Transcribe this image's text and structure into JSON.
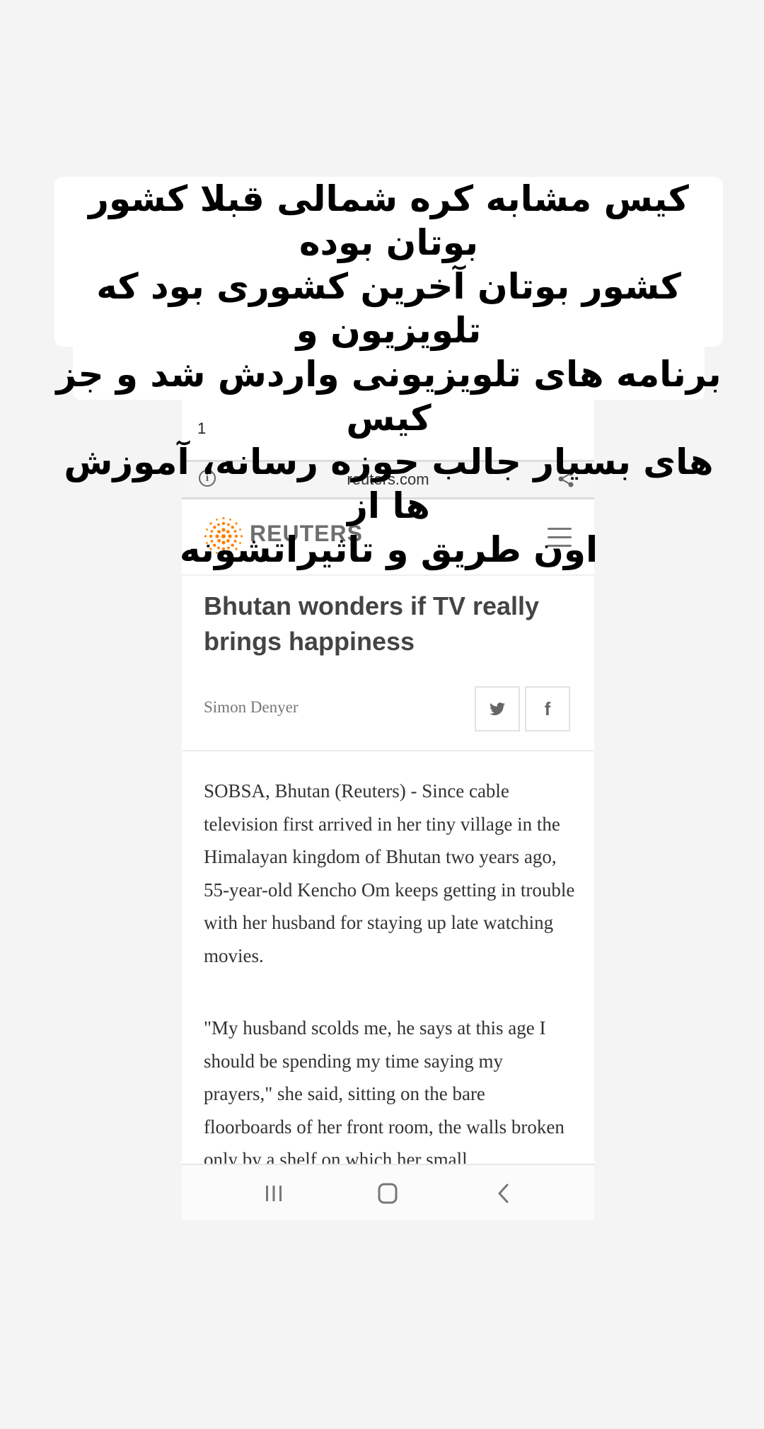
{
  "caption": {
    "lines": [
      "کیس مشابه کره شمالی قبلا کشور بوتان بوده",
      "کشور بوتان آخرین کشوری بود که تلویزیون و",
      "برنامه های تلویزیونی واردش شد و جز کیس",
      "های بسیار جالب حوزه رسانه، آموزش ها از",
      "اون طریق و تاثیراتشونه"
    ]
  },
  "status": {
    "text": "1"
  },
  "browser": {
    "url": "reuters.com"
  },
  "site": {
    "brand": "REUTERS",
    "brand_color": "#ff8000"
  },
  "article": {
    "headline": "Bhutan wonders if TV really brings happiness",
    "author": "Simon Denyer",
    "paragraphs": [
      "SOBSA, Bhutan (Reuters) - Since cable television first arrived in her tiny village in the Himalayan kingdom of Bhutan two years ago, 55-year-old Kencho Om keeps getting in trouble with her husband for staying up late watching movies.",
      "\"My husband scolds me, he says at this age I should be spending my time saying my prayers,\" she said, sitting on the bare floorboards of her front room, the walls broken only by a shelf on which her small"
    ]
  },
  "social": {
    "twitter_icon": "twitter-icon",
    "facebook_icon": "facebook-icon",
    "facebook_glyph": "f"
  }
}
